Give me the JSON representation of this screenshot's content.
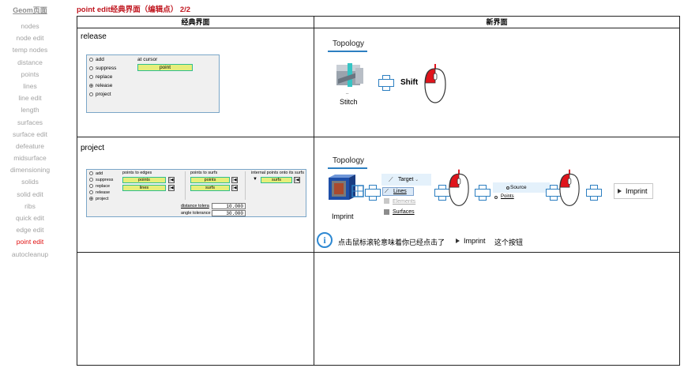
{
  "nav": {
    "header": "Geom页面",
    "items": [
      "nodes",
      "node edit",
      "temp nodes",
      "distance",
      "points",
      "lines",
      "line edit",
      "length",
      "surfaces",
      "surface edit",
      "defeature",
      "midsurface",
      "dimensioning",
      "solids",
      "solid edit",
      "ribs",
      "quick edit",
      "edge edit",
      "point edit",
      "autocleanup"
    ],
    "active": "point edit"
  },
  "title": "point edit经典界面（编辑点） 2/2",
  "table": {
    "col_classic": "经典界面",
    "col_new": "新界面",
    "row1_label": "release",
    "row2_label": "project"
  },
  "release_dialog": {
    "radios": [
      "add",
      "suppress",
      "replace",
      "release",
      "project"
    ],
    "selected": "release",
    "cursor_label": "at cursor",
    "field_value": "point"
  },
  "project_dialog": {
    "radios": [
      "add",
      "suppress",
      "replace",
      "release",
      "project"
    ],
    "selected": "project",
    "col1_header": "points to edges",
    "col1_fields": [
      "points",
      "lines"
    ],
    "col2_header": "points to surfs",
    "col2_fields": [
      "points",
      "surfs"
    ],
    "col3_header": "internal points onto its surfs",
    "col3_field": "surfs",
    "distance_label": "distance tolera",
    "distance_value": "10.000",
    "angle_label": "angle tolerance",
    "angle_value": "30.000"
  },
  "new_release": {
    "tab_title": "Topology",
    "tool_label": "Stitch",
    "tool_dots": "..",
    "modifier": "Shift"
  },
  "new_project": {
    "tab_title": "Topology",
    "tool_label": "Imprint",
    "target_label": "Target",
    "target_options": [
      "Lines",
      "Elements",
      "Surfaces"
    ],
    "source_label": "Source",
    "source_option": "Points",
    "button_label": "Imprint",
    "info_text": "点击鼠标滚轮意味着你已经点击了",
    "info_button": "Imprint",
    "info_suffix": "这个按钮"
  },
  "colors": {
    "title": "#c0161f",
    "nav_active": "#e01010",
    "accent": "#2d7fc1",
    "field_yellow": "#e6ee7a",
    "mouse_red": "#e0141c"
  }
}
